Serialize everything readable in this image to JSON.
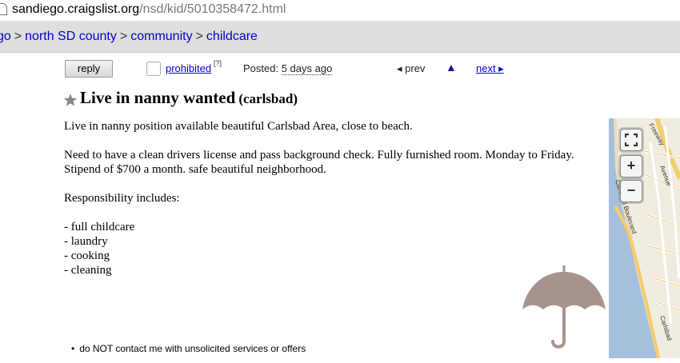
{
  "address_bar": {
    "host": "sandiego.craigslist.org",
    "path": "/nsd/kid/5010358472.html"
  },
  "breadcrumbs": [
    "go",
    "north SD county",
    "community",
    "childcare"
  ],
  "breadcrumb_separator": ">",
  "toolbar": {
    "reply_label": "reply",
    "prohibited_label": "prohibited",
    "help_marker": "[?]",
    "posted_label": "Posted:",
    "posted_value": "5 days ago",
    "prev_label": "◂ prev",
    "up_label": "▲",
    "next_label": "next ▸"
  },
  "posting": {
    "title": "Live in nanny wanted",
    "location": "(carlsbad)",
    "body": [
      "Live in nanny position available beautiful Carlsbad Area, close to beach.",
      "Need to have a clean drivers license and pass background check. Fully furnished room. Monday to Friday. Stipend of $700 a month. safe beautiful neighborhood.",
      "Responsibility includes:"
    ],
    "duties": [
      "- full childcare",
      "- laundry",
      "- cooking",
      "- cleaning"
    ]
  },
  "notice": "do NOT contact me with unsolicited services or offers",
  "map": {
    "street_labels": [
      "Freeway",
      "Avenue",
      "Carlsbad Boulevard",
      "Carlsbad"
    ],
    "controls": {
      "fullscreen_icon": "fullscreen-icon",
      "zoom_in": "+",
      "zoom_out": "−"
    }
  },
  "colors": {
    "link": "#0000cc",
    "crumb_bar": "#dedede",
    "map_ocean": "#a5bfdd",
    "map_road": "#f5cc6a",
    "umbrella": "#a7938e"
  }
}
